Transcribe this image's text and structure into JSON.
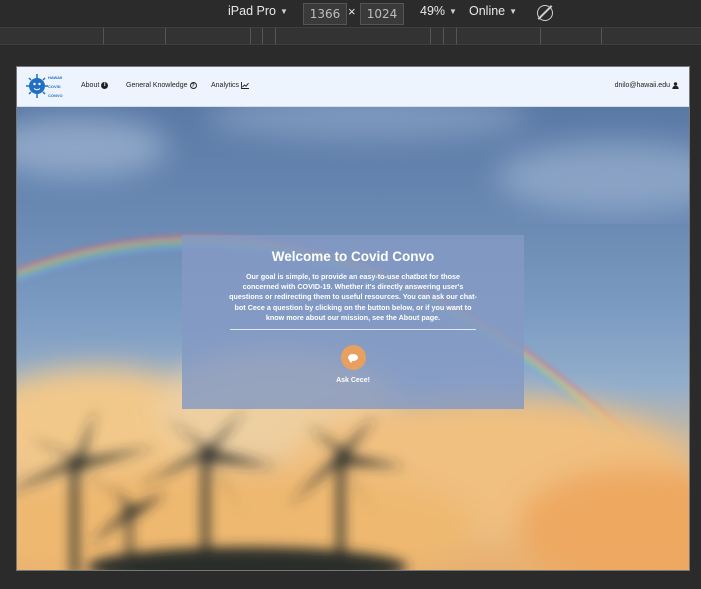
{
  "devtools": {
    "device": "iPad Pro",
    "width": "1366",
    "height": "1024",
    "zoom": "49%",
    "network": "Online",
    "times_symbol": "×"
  },
  "navbar": {
    "logo_text": [
      "HAWAII",
      "COVID",
      "CONVO"
    ],
    "links": [
      {
        "label": "About",
        "icon": "info-circle-icon"
      },
      {
        "label": "General Knowledge",
        "icon": "question-circle-icon"
      },
      {
        "label": "Analytics",
        "icon": "chart-icon"
      }
    ],
    "user_email": "dnilo@hawaii.edu",
    "user_icon": "user-icon"
  },
  "hero": {
    "title": "Welcome to Covid Convo",
    "description": "Our goal is simple, to provide an easy-to-use chatbot for those concerned with COVID-19. Whether it's directly answering user's questions or redirecting them to useful resources. You can ask our chat-bot Cece a question by clicking on the button below, or if you want to know more about our mission, see the About page.",
    "button_icon": "chat-bubble-icon",
    "button_label": "Ask Cece!"
  },
  "colors": {
    "navbar_bg": "#eef4fd",
    "card_bg": "#849ac4",
    "button": "#e8a060"
  }
}
